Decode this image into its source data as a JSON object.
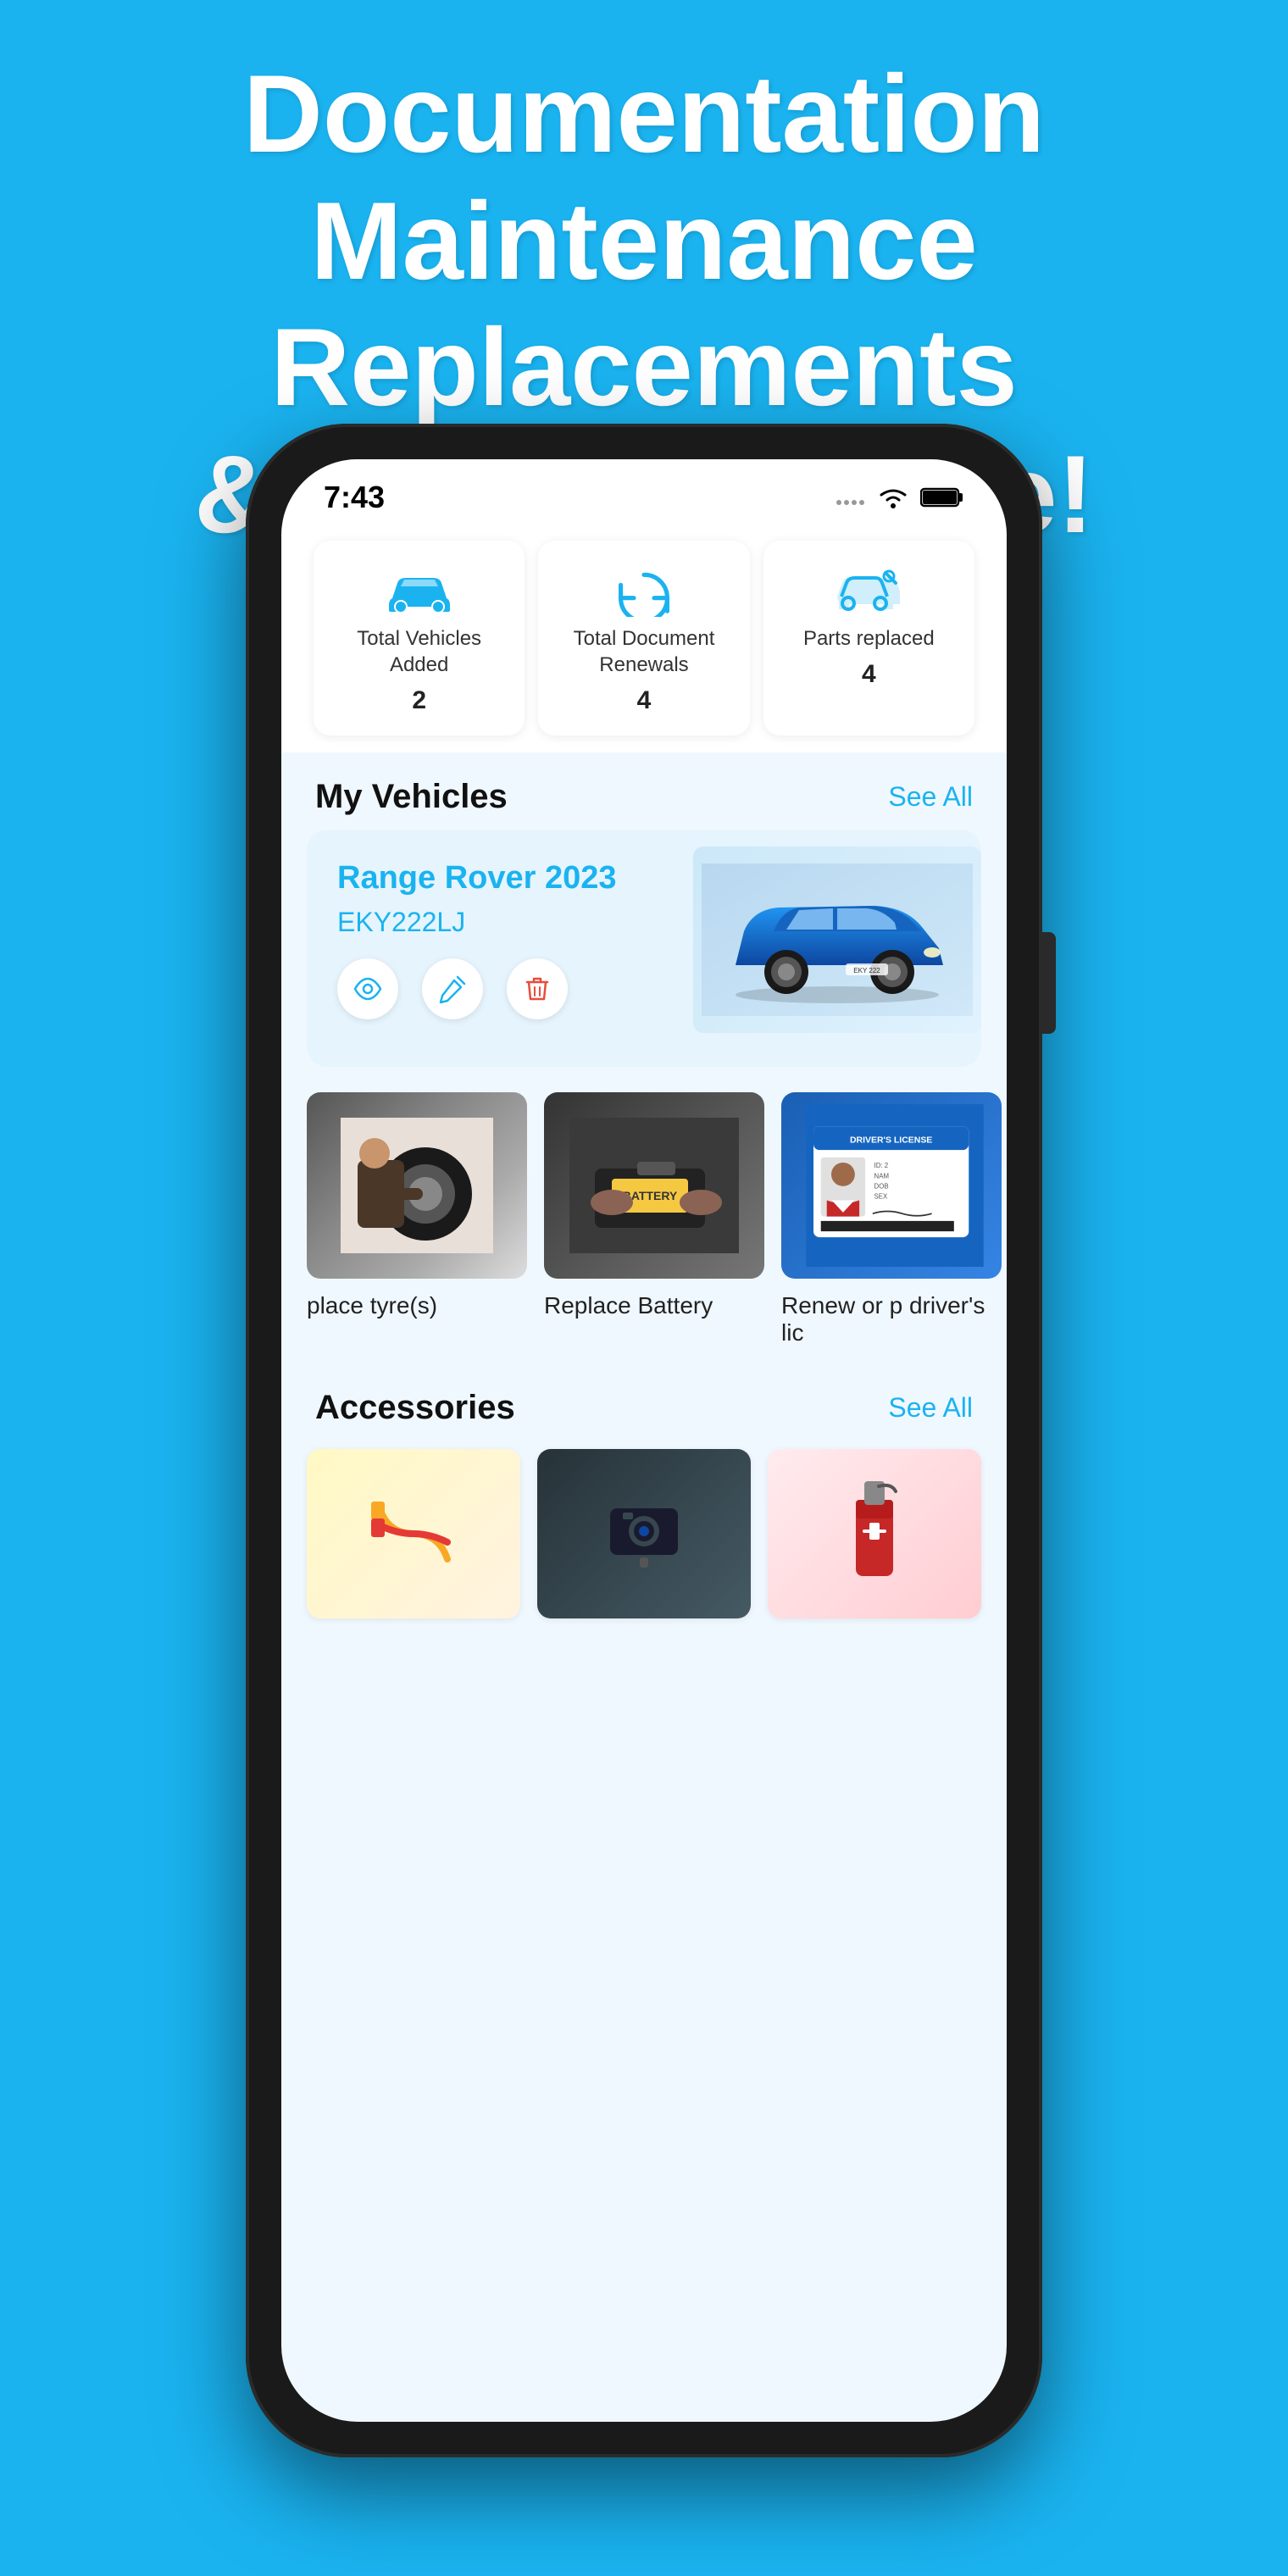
{
  "hero": {
    "line1": "Documentation",
    "line2": "Maintenance",
    "line3": "Replacements",
    "line4": "& So Much More!"
  },
  "statusBar": {
    "time": "7:43",
    "wifi": "wifi",
    "battery": "battery"
  },
  "stats": [
    {
      "id": "vehicles",
      "icon": "car",
      "label": "Total Vehicles Added",
      "value": "2"
    },
    {
      "id": "renewals",
      "icon": "refresh",
      "label": "Total Document Renewals",
      "value": "4"
    },
    {
      "id": "parts",
      "icon": "wrench",
      "label": "Parts replaced",
      "value": "4"
    }
  ],
  "myVehicles": {
    "sectionTitle": "My Vehicles",
    "seeAllLabel": "See All",
    "vehicle": {
      "name": "Range Rover 2023",
      "plate": "EKY222LJ"
    }
  },
  "services": [
    {
      "label": "place tyre(s)",
      "type": "tire"
    },
    {
      "label": "Replace Battery",
      "type": "battery"
    },
    {
      "label": "Renew or p driver's lic",
      "type": "license"
    }
  ],
  "accessories": {
    "sectionTitle": "Accessories",
    "seeAllLabel": "See All",
    "items": [
      {
        "id": "acc1"
      },
      {
        "id": "acc2"
      },
      {
        "id": "acc3"
      }
    ]
  }
}
